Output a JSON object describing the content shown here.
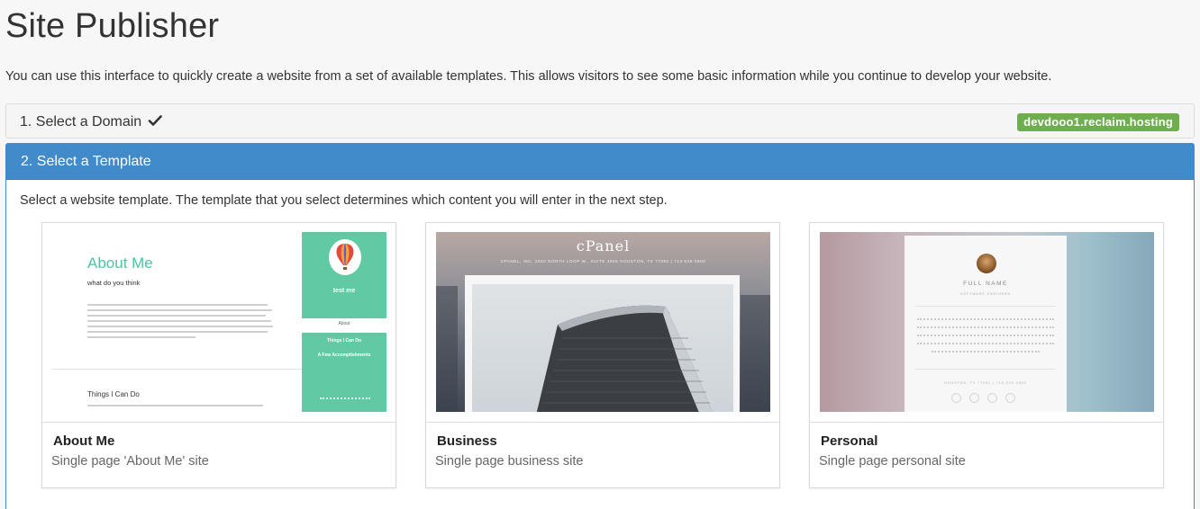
{
  "page": {
    "title": "Site Publisher",
    "intro": "You can use this interface to quickly create a website from a set of available templates. This allows visitors to see some basic information while you continue to develop your website."
  },
  "step1": {
    "label": "1. Select a Domain",
    "icon": "check-icon",
    "domain_badge": "devdooo1.reclaim.hosting",
    "badge_color": "#6fae4e"
  },
  "step2": {
    "label": "2. Select a Template",
    "description": "Select a website template. The template that you select determines which content you will enter in the next step.",
    "accent_color": "#428bca"
  },
  "templates": [
    {
      "name": "About Me",
      "description": "Single page 'About Me' site",
      "preview": {
        "heading": "About Me",
        "tagline": "what do you think",
        "section": "Things I Can Do",
        "sidebar_name": "test me",
        "sidebar_link": "About",
        "sidebar_item1": "Things I Can Do",
        "sidebar_item2": "A Few Accomplishments"
      }
    },
    {
      "name": "Business",
      "description": "Single page business site",
      "preview": {
        "brand": "cPanel",
        "address": "CPANEL, INC. 2550 NORTH LOOP W., SUITE 4006 HOUSTON, TX 77092 | 713-529-0800"
      }
    },
    {
      "name": "Personal",
      "description": "Single page personal site",
      "preview": {
        "full_name": "FULL NAME",
        "role": "SOFTWARE ENGINEER",
        "footer": "HOUSTON, TX 77092 | 713-529-0800"
      }
    }
  ]
}
